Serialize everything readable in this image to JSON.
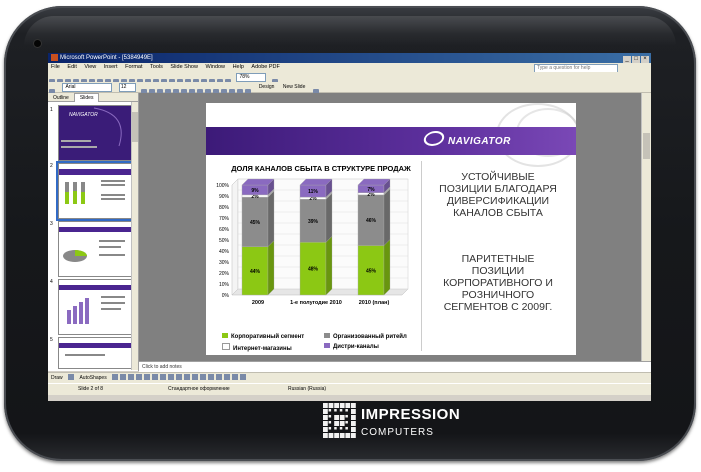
{
  "window": {
    "title": "Microsoft PowerPoint - [5384949E]"
  },
  "menu": {
    "items": [
      "File",
      "Edit",
      "View",
      "Insert",
      "Format",
      "Tools",
      "Slide Show",
      "Window",
      "Help",
      "Adobe PDF"
    ],
    "help_placeholder": "Type a question for help"
  },
  "toolbar": {
    "zoom": "78%",
    "font": "Arial",
    "font_size": "12",
    "design_label": "Design",
    "new_slide_label": "New Slide"
  },
  "pane": {
    "tabs": [
      "Outline",
      "Slides"
    ],
    "thumb_numbers": [
      "1",
      "2",
      "3",
      "4",
      "5"
    ]
  },
  "slide": {
    "logo_text": "NAVIGATOR",
    "headline1": [
      "УСТОЙЧИВЫЕ",
      "ПОЗИЦИИ БЛАГОДАРЯ",
      "ДИВЕРСИФИКАЦИИ",
      "КАНАЛОВ СБЫТА"
    ],
    "headline2": [
      "ПАРИТЕТНЫЕ",
      "ПОЗИЦИИ",
      "КОРПОРАТИВНОГО И",
      "РОЗНИЧНОГО",
      "СЕГМЕНТОВ С 2009Г."
    ]
  },
  "chart_data": {
    "type": "bar",
    "title": "ДОЛЯ КАНАЛОВ СБЫТА В СТРУКТУРЕ ПРОДАЖ",
    "categories": [
      "2009",
      "1-е полугодие 2010",
      "2010 (план)"
    ],
    "series": [
      {
        "name": "Корпоративный сегмент",
        "color": "#8cc814",
        "values": [
          44,
          48,
          45
        ],
        "labels": [
          "44%",
          "48%",
          "45%"
        ]
      },
      {
        "name": "Организованный ритейл",
        "color": "#8c8c8c",
        "values": [
          45,
          39,
          46
        ],
        "labels": [
          "45%",
          "39%",
          "46%"
        ]
      },
      {
        "name": "Интернет-магазины",
        "color": "#ffffff",
        "values": [
          2,
          2,
          2
        ],
        "labels": [
          "2%",
          "2%",
          "2%"
        ]
      },
      {
        "name": "Дистри-каналы",
        "color": "#8a6ac0",
        "values": [
          9,
          11,
          7
        ],
        "labels": [
          "9%",
          "11%",
          "7%"
        ]
      }
    ],
    "y_ticks": [
      "0%",
      "10%",
      "20%",
      "30%",
      "40%",
      "50%",
      "60%",
      "70%",
      "80%",
      "90%",
      "100%"
    ],
    "ylim": [
      0,
      100
    ],
    "legend_position": "bottom"
  },
  "notes": {
    "placeholder": "Click to add notes"
  },
  "drawbar": {
    "draw_label": "Draw",
    "autoshapes_label": "AutoShapes"
  },
  "status": {
    "slide": "Slide 2 of 8",
    "design": "Стандартное оформление",
    "language": "Russian (Russia)"
  },
  "brand": {
    "line1": "IMPRESSION",
    "line2": "COMPUTERS"
  }
}
